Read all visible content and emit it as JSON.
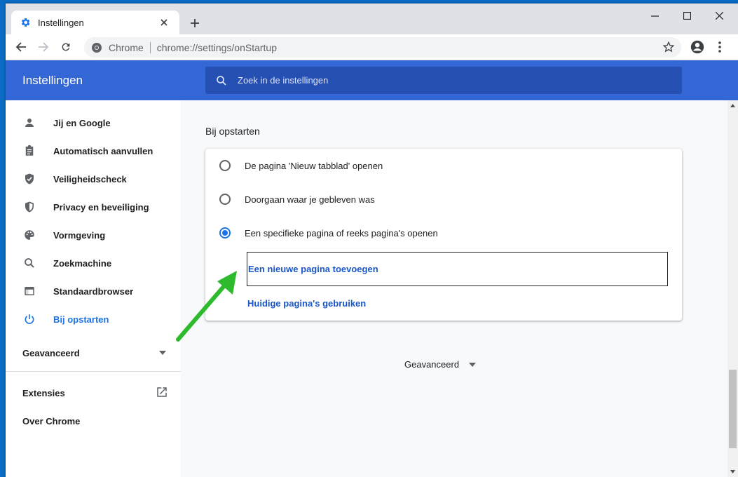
{
  "browser": {
    "tab": {
      "title": "Instellingen",
      "icon": "gear-icon"
    },
    "omnibox": {
      "chip": "Chrome",
      "url": "chrome://settings/onStartup"
    }
  },
  "header": {
    "title": "Instellingen",
    "search_placeholder": "Zoek in de instellingen"
  },
  "sidebar": {
    "items": [
      {
        "label": "Jij en Google",
        "icon": "person-icon"
      },
      {
        "label": "Automatisch aanvullen",
        "icon": "clipboard-icon"
      },
      {
        "label": "Veiligheidscheck",
        "icon": "shield-check-icon"
      },
      {
        "label": "Privacy en beveiliging",
        "icon": "shield-icon"
      },
      {
        "label": "Vormgeving",
        "icon": "palette-icon"
      },
      {
        "label": "Zoekmachine",
        "icon": "search-icon"
      },
      {
        "label": "Standaardbrowser",
        "icon": "browser-icon"
      },
      {
        "label": "Bij opstarten",
        "icon": "power-icon",
        "active": true
      }
    ],
    "advanced": "Geavanceerd",
    "extensions": "Extensies",
    "about": "Over Chrome"
  },
  "main": {
    "section_title": "Bij opstarten",
    "options": [
      {
        "label": "De pagina 'Nieuw tabblad' openen",
        "checked": false
      },
      {
        "label": "Doorgaan waar je gebleven was",
        "checked": false
      },
      {
        "label": "Een specifieke pagina of reeks pagina's openen",
        "checked": true
      }
    ],
    "add_page": "Een nieuwe pagina toevoegen",
    "use_current": "Huidige pagina's gebruiken",
    "advanced": "Geavanceerd"
  },
  "colors": {
    "header_blue": "#3367d6",
    "accent": "#1a73e8",
    "annotation_arrow": "#2dbb2d"
  }
}
